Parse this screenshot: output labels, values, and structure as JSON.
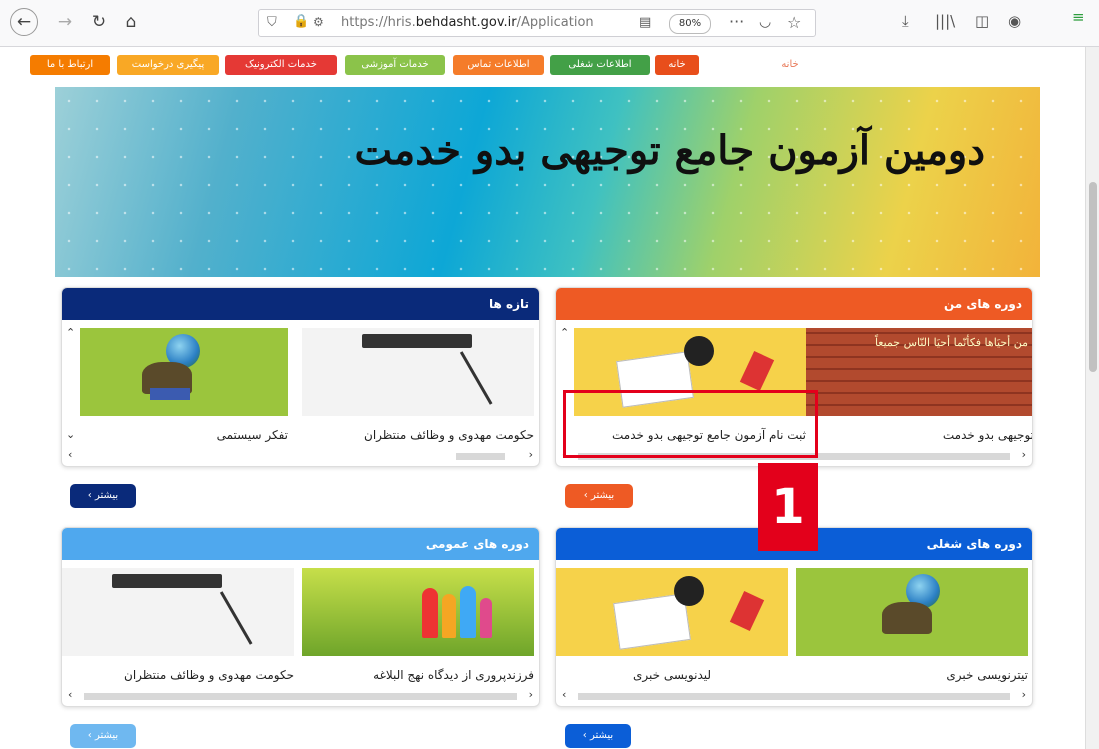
{
  "browser": {
    "url_prefix": "https://hris.",
    "url_domain": "behdasht.gov.ir",
    "url_suffix": "/Application",
    "zoom": "80%"
  },
  "menu": [
    {
      "label": "خانه",
      "color": "#e84e1b",
      "style": "text"
    },
    {
      "label": "خانه",
      "color": "#e84e1b"
    },
    {
      "label": "اطلاعات شغلی",
      "color": "#43a047"
    },
    {
      "label": "اطلاعات تماس",
      "color": "#f57c2a"
    },
    {
      "label": "خدمات آموزشی",
      "color": "#8bc34a"
    },
    {
      "label": "خدمات الکترونیک",
      "color": "#e53935"
    },
    {
      "label": "پیگیری درخواست",
      "color": "#f9a825"
    },
    {
      "label": "ارتباط با ما",
      "color": "#f57c00"
    }
  ],
  "banner": {
    "title": "دومین آزمون جامع توجیهی بدو خدمت"
  },
  "panels": {
    "my_courses": {
      "title": "دوره های من",
      "color": "#ee5a24",
      "cards": [
        "توجیهی بدو خدمت",
        "ثبت نام آزمون جامع توجیهی بدو خدمت"
      ],
      "more": "بیشتر"
    },
    "news": {
      "title": "تازه ها",
      "color": "#0a2a7a",
      "cards": [
        "حکومت مهدوی و وظائف منتظران",
        "تفکر سیستمی"
      ],
      "more": "بیشتر"
    },
    "job_courses": {
      "title": "دوره های شغلی",
      "color": "#0b5ed7",
      "cards": [
        "تیترنویسی خبری",
        "لیدنویسی خبری"
      ],
      "more": "بیشتر"
    },
    "general_courses": {
      "title": "دوره های عمومی",
      "color": "#4fa8ee",
      "cards": [
        "فرزندپروری از دیدگاه نهج البلاغه",
        "حکومت مهدوی و وظائف منتظران"
      ],
      "more": "بیشتر"
    }
  },
  "brick_text": "من أحيَاها فكأنّما أحيَا النّاس جميعاً",
  "annotation": {
    "number": "1"
  }
}
